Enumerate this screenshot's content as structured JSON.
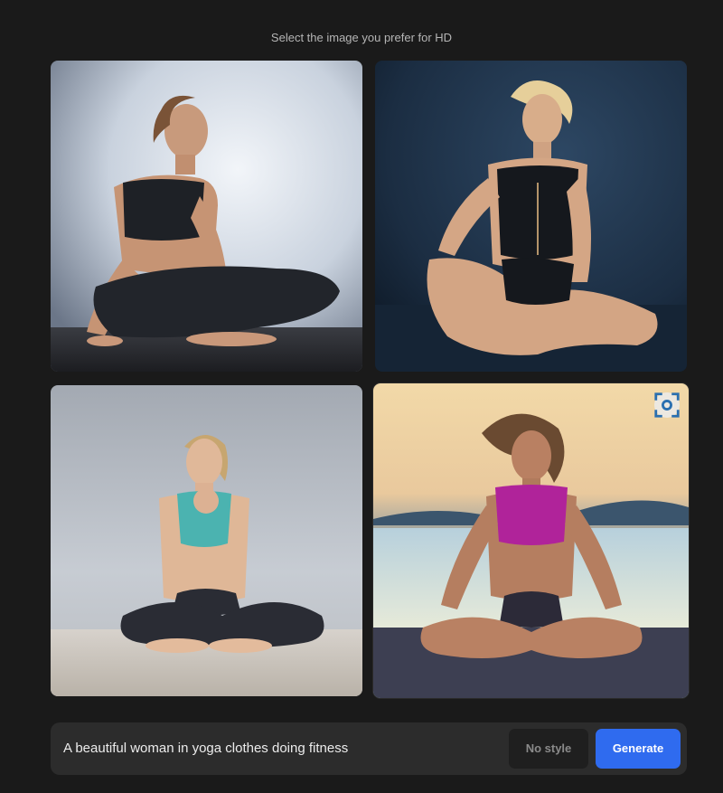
{
  "header": {
    "instruction": "Select the image you prefer for HD"
  },
  "images": [
    {
      "description": "woman in black sports top and leggings sitting cross-legged on reflective floor, light grey backdrop"
    },
    {
      "description": "blonde woman in black zip top and shorts seated on floor, dark blue backdrop"
    },
    {
      "description": "woman in teal sports bra sitting cross-legged with hands clasped, grey studio"
    },
    {
      "description": "woman in magenta sports bra in meditation pose by the lake at sunset"
    }
  ],
  "image_actions": {
    "expand_icon": "focus-expand-icon"
  },
  "prompt_bar": {
    "prompt": "A beautiful woman in yoga clothes doing fitness",
    "style_label": "No style",
    "generate_label": "Generate"
  },
  "colors": {
    "background": "#1a1a1a",
    "prompt_bar": "#2c2c2c",
    "accent": "#2f6bef"
  }
}
